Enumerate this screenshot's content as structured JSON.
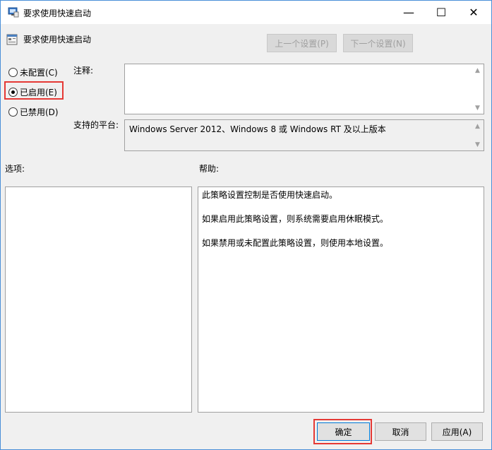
{
  "window": {
    "title": "要求使用快速启动",
    "controls": {
      "minimize": "—",
      "maximize": "☐",
      "close": "✕"
    }
  },
  "policy": {
    "title": "要求使用快速启动",
    "prev_setting": "上一个设置(P)",
    "next_setting": "下一个设置(N)"
  },
  "state_options": [
    {
      "label": "未配置(C)",
      "selected": false
    },
    {
      "label": "已启用(E)",
      "selected": true
    },
    {
      "label": "已禁用(D)",
      "selected": false
    }
  ],
  "fields": {
    "comment_label": "注释:",
    "comment_value": "",
    "platform_label": "支持的平台:",
    "platform_value": "Windows Server 2012、Windows 8 或 Windows RT 及以上版本",
    "options_label": "选项:",
    "help_label": "帮助:"
  },
  "help_text": [
    "此策略设置控制是否使用快速启动。",
    "如果启用此策略设置，则系统需要启用休眠模式。",
    "如果禁用或未配置此策略设置，则使用本地设置。"
  ],
  "buttons": {
    "ok": "确定",
    "cancel": "取消",
    "apply": "应用(A)"
  },
  "colors": {
    "highlight": "#e53935",
    "accent": "#0078d7"
  },
  "icons": {
    "window": "policy-window-icon",
    "policy": "policy-setting-icon"
  }
}
